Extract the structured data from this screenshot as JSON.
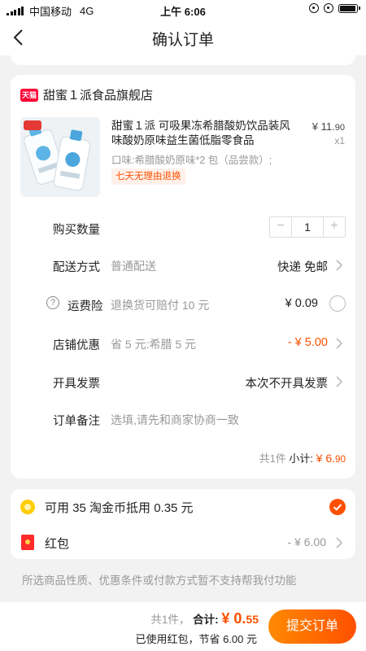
{
  "status_bar": {
    "carrier": "中国移动",
    "network": "4G",
    "time": "上午 6:06",
    "battery_level": 0.85
  },
  "nav": {
    "title": "确认订单",
    "back_icon": "chevron-left-icon"
  },
  "shop": {
    "badge": "天猫",
    "name": "甜蜜１派食品旗舰店"
  },
  "product": {
    "title": "甜蜜１派 可吸果冻希腊酸奶饮品装风味酸奶原味益生菌低脂零食品",
    "price_main": "¥ 11.",
    "price_decimal": "90",
    "quantity": "x1",
    "spec": "口味:希腊酸奶原味*2 包（品尝款）;",
    "tag": "七天无理由退换"
  },
  "rows": {
    "quantity_label": "购买数量",
    "quantity_minus": "−",
    "quantity_value": "1",
    "quantity_plus": "+",
    "delivery_label": "配送方式",
    "delivery_sub": "普通配送",
    "delivery_value": "快递 免邮",
    "insurance_icon": "?",
    "insurance_label": "运费险",
    "insurance_sub": "退换货可赔付 10 元",
    "insurance_value": "¥ 0.09",
    "discount_label": "店铺优惠",
    "discount_sub": "省 5 元:希腊 5 元",
    "discount_value": "- ¥ 5.00",
    "invoice_label": "开具发票",
    "invoice_value": "本次不开具发票",
    "note_label": "订单备注",
    "note_placeholder": "选填,请先和商家协商一致"
  },
  "subtotal": {
    "count": "共1件",
    "label": "小计:",
    "amount_main": "¥ 6.",
    "amount_decimal": "90"
  },
  "coins": {
    "text": "可用 35 淘金币抵用 0.35 元",
    "checked": true
  },
  "red_packet": {
    "label": "红包",
    "value": "- ¥ 6.00"
  },
  "notice": "所选商品性质、优惠条件或付款方式暂不支持帮我付功能",
  "bottom": {
    "count": "共1件，",
    "total_label": "合计:",
    "total_main": "¥ 0.",
    "total_decimal": "55",
    "saved": "已使用红包，节省 6.00 元",
    "submit": "提交订单"
  },
  "colors": {
    "accent": "#ff5000",
    "tmall_red": "#ff0036",
    "background": "#f2f2f2"
  }
}
